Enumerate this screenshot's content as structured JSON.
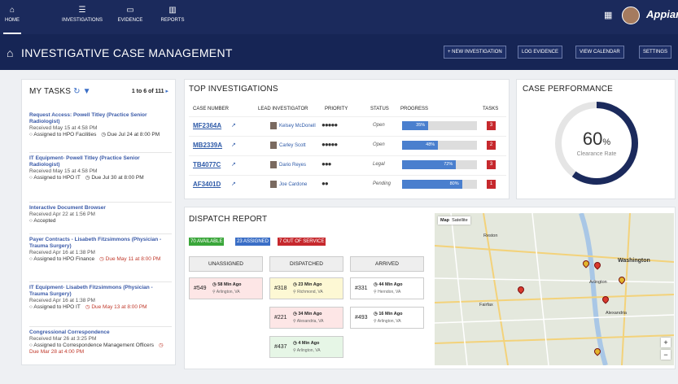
{
  "nav": [
    {
      "label": "HOME",
      "icon": "home-icon",
      "glyph": "⌂"
    },
    {
      "label": "INVESTIGATIONS",
      "icon": "list-icon",
      "glyph": "☰"
    },
    {
      "label": "EVIDENCE",
      "icon": "inbox-icon",
      "glyph": "▭"
    },
    {
      "label": "REPORTS",
      "icon": "bar-chart-icon",
      "glyph": "▥"
    }
  ],
  "header": {
    "title": "INVESTIGATIVE CASE MANAGEMENT",
    "logo": "Appian",
    "buttons": [
      "+ NEW INVESTIGATION",
      "LOG EVIDENCE",
      "VIEW CALENDAR",
      "SETTINGS"
    ]
  },
  "tasks": {
    "title": "MY TASKS",
    "count": "1 to 6 of 111",
    "items": [
      {
        "title": "Request Access: Powell Titley (Practice Senior Radiologist)",
        "received": "Received May 15 at 4:58 PM",
        "assigned": "Assigned to HPO Facilities",
        "due": "Due Jul 24 at 8:00 PM",
        "overdue": false
      },
      {
        "title": "IT Equipment- Powell Titley (Practice Senior Radiologist)",
        "received": "Received May 15 at 4:58 PM",
        "assigned": "Assigned to HPO IT",
        "due": "Due Jul 30 at 8:00 PM",
        "overdue": false
      },
      {
        "title": "Interactive Document Browser",
        "received": "Received Apr 22 at 1:56 PM",
        "assigned": "Accepted",
        "due": "",
        "overdue": false
      },
      {
        "title": "Payer Contracts - Lisabeth Fitzsimmons (Physician - Trauma Surgery)",
        "received": "Received Apr 16 at 1:38 PM",
        "assigned": "Assigned to HPO Finance",
        "due": "Due May 11 at 8:00 PM",
        "overdue": true
      },
      {
        "title": "IT Equipment- Lisabeth Fitzsimmons (Physician - Trauma Surgery)",
        "received": "Received Apr 16 at 1:38 PM",
        "assigned": "Assigned to HPO IT",
        "due": "Due May 13 at 8:00 PM",
        "overdue": true
      },
      {
        "title": "Congressional Correspondence",
        "received": "Received Mar 26 at 3:25 PM",
        "assigned": "Assigned to Correspondence Management Officers",
        "due": "Due Mar 28 at 4:00 PM",
        "overdue": true
      }
    ]
  },
  "top": {
    "title": "TOP INVESTIGATIONS",
    "headers": [
      "CASE NUMBER",
      "LEAD INVESTIGATOR",
      "PRIORITY",
      "STATUS",
      "PROGRESS",
      "TASKS"
    ],
    "rows": [
      {
        "case": "MF2364A",
        "lead": "Kelsey McDonell",
        "priority": "●●●●●",
        "status": "Open",
        "progress": 35,
        "progress_label": "35%",
        "tasks": "3"
      },
      {
        "case": "MB2339A",
        "lead": "Carley Scott",
        "priority": "●●●●●",
        "status": "Open",
        "progress": 48,
        "progress_label": "48%",
        "tasks": "2"
      },
      {
        "case": "TB4077C",
        "lead": "Dario Reyes",
        "priority": "●●●",
        "status": "Legal",
        "progress": 72,
        "progress_label": "72%",
        "tasks": "3"
      },
      {
        "case": "AF3401D",
        "lead": "Joe Cardone",
        "priority": "●●",
        "status": "Pending",
        "progress": 80,
        "progress_label": "80%",
        "tasks": "1"
      }
    ]
  },
  "perf": {
    "title": "CASE PERFORMANCE",
    "value": 60,
    "value_label": "60",
    "unit": "%",
    "caption": "Clearance Rate"
  },
  "dispatch": {
    "title": "DISPATCH REPORT",
    "badges": [
      {
        "label": "70 AVAILABLE",
        "color": "#3aa63a"
      },
      {
        "label": "23 ASSIGNED",
        "color": "#3a6ec6"
      },
      {
        "label": "7 OUT OF SERVICE",
        "color": "#c6282d"
      }
    ],
    "columns": [
      "UNASSIGNED",
      "DISPATCHED",
      "ARRIVED"
    ],
    "unassigned": [
      {
        "num": "#549",
        "time": "58 Min Ago",
        "loc": "Arlington, VA"
      }
    ],
    "dispatched": [
      {
        "num": "#318",
        "time": "23 Min Ago",
        "loc": "Richmond, VA"
      },
      {
        "num": "#221",
        "time": "34 Min Ago",
        "loc": "Alexandria, VA"
      },
      {
        "num": "#437",
        "time": "4 Min Ago",
        "loc": "Arlington, VA"
      }
    ],
    "arrived": [
      {
        "num": "#331",
        "time": "44 Min Ago",
        "loc": "Herndon, VA"
      },
      {
        "num": "#493",
        "time": "16 Min Ago",
        "loc": "Arlington, VA"
      }
    ],
    "map": {
      "tabs": [
        "Map",
        "Satellite"
      ],
      "labels": [
        "Washington",
        "Arlington",
        "Alexandria",
        "Reston",
        "Fairfax"
      ]
    }
  }
}
